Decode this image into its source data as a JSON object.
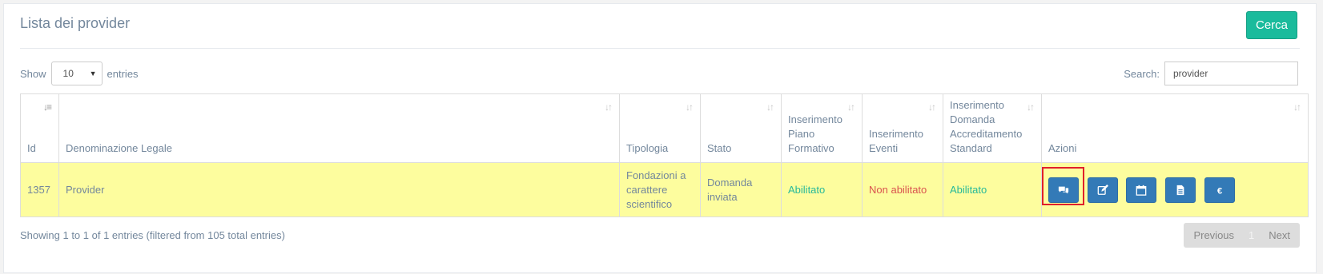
{
  "panel": {
    "title": "Lista dei provider",
    "search_button": "Cerca"
  },
  "length": {
    "prefix": "Show",
    "value": "10",
    "suffix": "entries"
  },
  "search": {
    "label": "Search:",
    "value": "provider"
  },
  "table": {
    "headers": [
      "Id",
      "Denominazione Legale",
      "Tipologia",
      "Stato",
      "Inserimento Piano Formativo",
      "Inserimento Eventi",
      "Inserimento Domanda Accreditamento Standard",
      "Azioni"
    ],
    "rows": [
      {
        "id": "1357",
        "denominazione": "Provider",
        "tipologia": "Fondazioni a carattere scientifico",
        "stato": "Domanda inviata",
        "piano_formativo": "Abilitato",
        "eventi": "Non abilitato",
        "accreditamento": "Abilitato"
      }
    ],
    "action_icons": [
      "comments-icon",
      "edit-icon",
      "calendar-icon",
      "file-text-icon",
      "euro-icon"
    ]
  },
  "footer": {
    "info": "Showing 1 to 1 of 1 entries (filtered from 105 total entries)",
    "previous": "Previous",
    "page": "1",
    "next": "Next"
  },
  "colors": {
    "highlight_row": "#fdfd9e",
    "accent_green": "#1abb9c",
    "primary_blue": "#337ab7",
    "enabled": "#26b99a",
    "disabled": "#d9534f"
  }
}
